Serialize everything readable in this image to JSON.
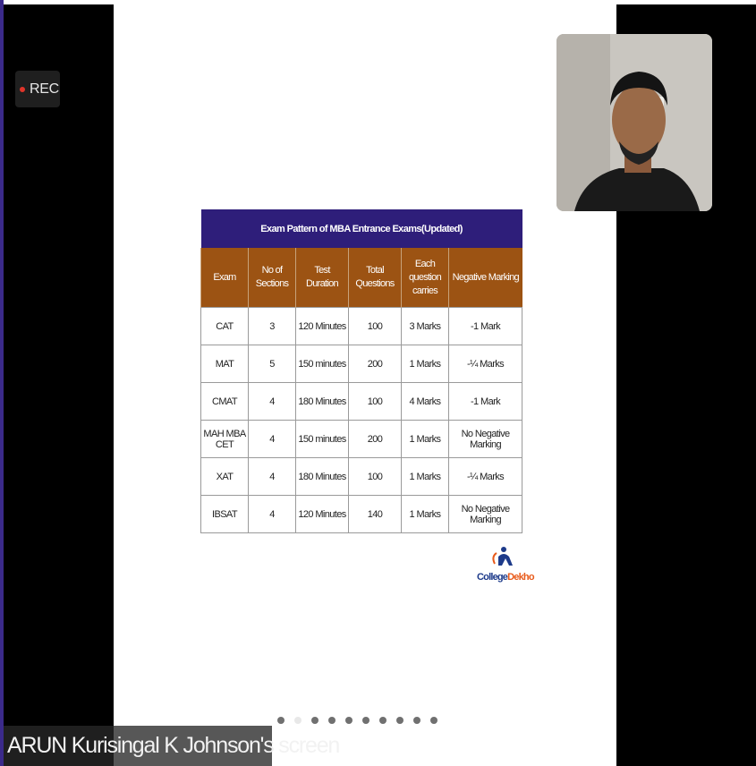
{
  "recording": {
    "label": "REC"
  },
  "table": {
    "title": "Exam Pattern of MBA Entrance Exams(Updated)",
    "headers": [
      "Exam",
      "No of Sections",
      "Test Duration",
      "Total Questions",
      "Each question carries",
      "Negative Marking"
    ],
    "rows": [
      [
        "CAT",
        "3",
        "120 Minutes",
        "100",
        "3 Marks",
        "-1 Mark"
      ],
      [
        "MAT",
        "5",
        "150 minutes",
        "200",
        "1 Marks",
        "-¼ Marks"
      ],
      [
        "CMAT",
        "4",
        "180 Minutes",
        "100",
        "4 Marks",
        "-1 Mark"
      ],
      [
        "MAH MBA CET",
        "4",
        "150 minutes",
        "200",
        "1 Marks",
        "No Negative Marking"
      ],
      [
        "XAT",
        "4",
        "180 Minutes",
        "100",
        "1 Marks",
        "-¼ Marks"
      ],
      [
        "IBSAT",
        "4",
        "120 Minutes",
        "140",
        "1 Marks",
        "No Negative Marking"
      ]
    ]
  },
  "logo": {
    "part1": "College",
    "part2": "Dekho"
  },
  "slide_dots": {
    "count": 10,
    "active_index": 1
  },
  "screen_share": {
    "label": "ARUN Kurisingal K Johnson's screen"
  },
  "colors": {
    "title_bg": "#2e1e7a",
    "header_bg": "#9c5313"
  }
}
